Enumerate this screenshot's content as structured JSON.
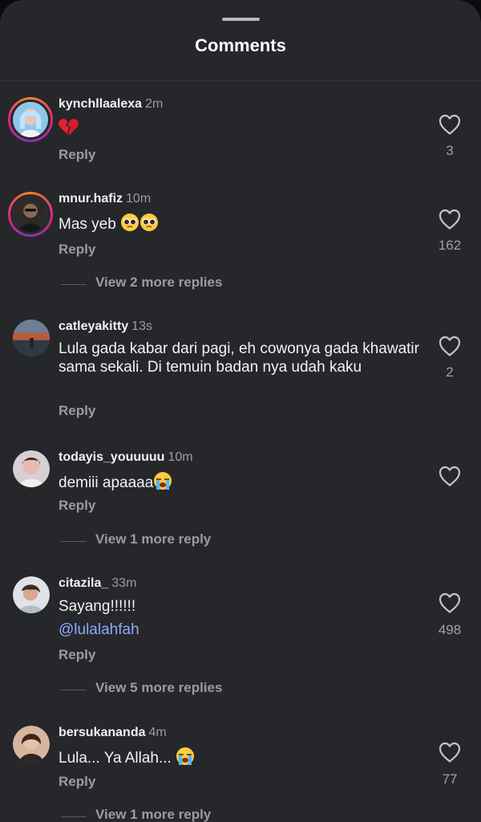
{
  "sheet": {
    "title": "Comments"
  },
  "actions": {
    "reply_label": "Reply"
  },
  "comments": [
    {
      "username": "kynchllaalexa",
      "time": "2m",
      "text": "",
      "emoji": "broken-heart",
      "likes": "3",
      "view_more": ""
    },
    {
      "username": "mnur.hafiz",
      "time": "10m",
      "text": "Mas yeb",
      "emoji": "pleading-face x2",
      "likes": "162",
      "view_more": "View 2 more replies"
    },
    {
      "username": "catleyakitty",
      "time": "13s",
      "text": "Lula gada kabar dari pagi, eh cowonya gada khawatir sama sekali. Di temuin badan nya udah kaku",
      "likes": "2",
      "view_more": ""
    },
    {
      "username": "todayis_youuuuu",
      "time": "10m",
      "text": "demiii apaaaa",
      "emoji": "loudly-crying-face",
      "likes": "",
      "view_more": "View 1 more reply"
    },
    {
      "username": "citazila_",
      "time": "33m",
      "text": "Sayang!!!!!!",
      "mention": "@lulalahfah",
      "likes": "498",
      "view_more": "View 5 more replies"
    },
    {
      "username": "bersukananda",
      "time": "4m",
      "text": "Lula... Ya Allah...",
      "emoji": "loudly-crying-face",
      "likes": "77",
      "view_more": "View 1 more reply"
    }
  ],
  "colors": {
    "background": "#26272b",
    "text_primary": "#f2f2f2",
    "text_secondary": "#9b9ca1",
    "mention": "#8fa9ff",
    "story_ring": [
      "#f58529",
      "#dd2a7b",
      "#8134af"
    ]
  }
}
